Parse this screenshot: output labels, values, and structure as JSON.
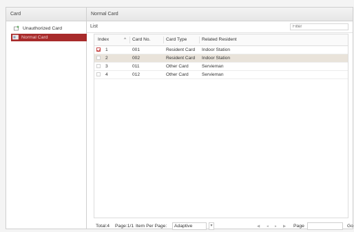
{
  "left": {
    "header": "Card",
    "tree": [
      {
        "label": "Unauthorized Card",
        "selected": false
      },
      {
        "label": "Normal Card",
        "selected": true
      }
    ]
  },
  "right": {
    "header": "Normal Card",
    "list_label": "List",
    "filter_placeholder": "Filter",
    "columns": {
      "index": "Index",
      "sort": "^",
      "card_no": "Card No.",
      "card_type": "Card Type",
      "resident": "Related Resident"
    },
    "rows": [
      {
        "checked": true,
        "index": "1",
        "card_no": "001",
        "card_type": "Resident Card",
        "resident": "Indoor Station"
      },
      {
        "checked": false,
        "index": "2",
        "card_no": "002",
        "card_type": "Resident Card",
        "resident": "Indoor Station"
      },
      {
        "checked": false,
        "index": "3",
        "card_no": "011",
        "card_type": "Other Card",
        "resident": "Servieman"
      },
      {
        "checked": false,
        "index": "4",
        "card_no": "012",
        "card_type": "Other Card",
        "resident": "Servieman"
      }
    ],
    "footer": {
      "total": "Total:4",
      "page_info": "Page:1/1",
      "per_page_label": "Item Per Page:",
      "per_page_value": "Adaptive",
      "page_label": "Page",
      "go": "Go"
    }
  },
  "colors": {
    "selected_tree": "#a82b2b",
    "selected_row": "#e9e3da"
  }
}
